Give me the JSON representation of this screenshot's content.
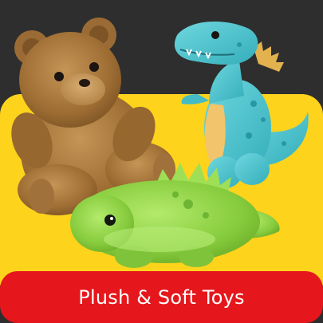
{
  "tile": {
    "label": "Plush & Soft Toys",
    "illustration_items": [
      "teddy-bear-icon",
      "dinosaur-icon",
      "stegosaurus-icon"
    ]
  },
  "colors": {
    "page_background": "#2e2e2e",
    "panel_yellow": "#fdd31c",
    "label_bar_red": "#e5171c",
    "label_text": "#ffffff",
    "bear_fur": "#a9793e",
    "dino_blue": "#4ec6cf",
    "dino_belly": "#f2c46b",
    "stego_green": "#8fd245"
  }
}
